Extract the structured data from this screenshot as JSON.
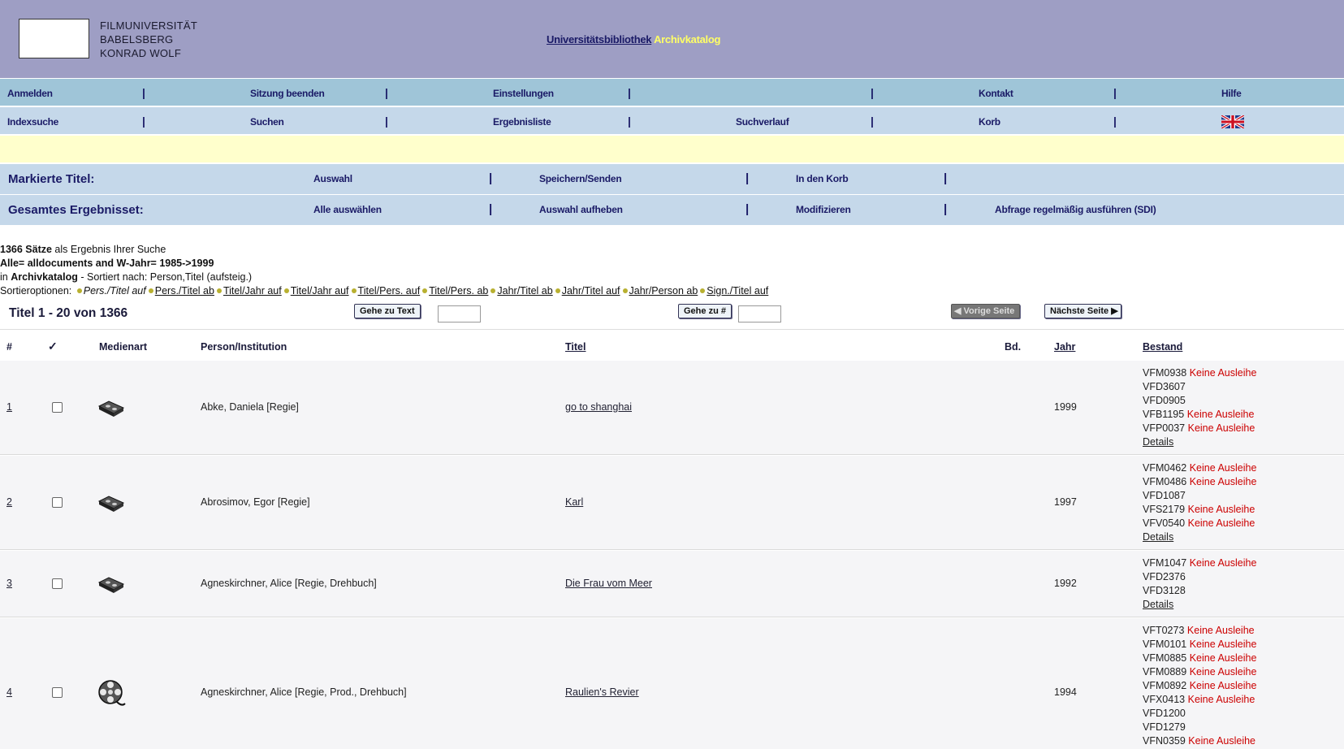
{
  "header": {
    "logo_lines": [
      "FILMUNIVERSITÄT",
      "BABELSBERG",
      "KONRAD WOLF"
    ],
    "library_link": "Universitätsbibliothek",
    "catalog": "Archivkatalog"
  },
  "nav1": [
    "Anmelden",
    "Sitzung beenden",
    "Einstellungen",
    "",
    "Kontakt",
    "Hilfe"
  ],
  "nav2": [
    "Indexsuche",
    "Suchen",
    "Ergebnisliste",
    "Suchverlauf",
    "Korb"
  ],
  "separator": "|",
  "marked": {
    "label": "Markierte Titel:",
    "items": [
      "Auswahl",
      "Speichern/Senden",
      "In den Korb"
    ]
  },
  "all": {
    "label": "Gesamtes Ergebnisset:",
    "items": [
      "Alle auswählen",
      "Auswahl aufheben",
      "Modifizieren",
      "Abfrage regelmäßig ausführen (SDI)"
    ]
  },
  "info": {
    "count_bold": "1366 Sätze",
    "count_rest": " als Ergebnis Ihrer Suche",
    "query": "Alle= alldocuments and W-Jahr= 1985->1999",
    "in_prefix": "in ",
    "in_catalog": "Archivkatalog",
    "sorted": " - Sortiert nach: Person,Titel (aufsteig.)",
    "sort_label": "Sortieroptionen: ",
    "sort_current": "Pers./Titel auf",
    "sort_options": [
      "Pers./Titel ab",
      "Titel/Jahr auf",
      "Titel/Jahr auf",
      "Titel/Pers. auf",
      "Titel/Pers. ab",
      "Jahr/Titel ab",
      "Jahr/Titel auf",
      "Jahr/Person ab",
      "Sign./Titel auf"
    ]
  },
  "titlebar": {
    "range": "Titel 1 - 20 von 1366",
    "goto_text": "Gehe zu Text",
    "goto_num": "Gehe zu #",
    "prev": "Vorige Seite",
    "next": "Nächste Seite"
  },
  "columns": {
    "num": "#",
    "check": "✓",
    "media": "Medienart",
    "person": "Person/Institution",
    "title": "Titel",
    "vol": "Bd.",
    "year": "Jahr",
    "holdings": "Bestand"
  },
  "rows": [
    {
      "num": "1",
      "media": "video-cassette-icon",
      "person": "Abke, Daniela [Regie]",
      "title": "go to shanghai ",
      "year": "1999",
      "holdings": [
        {
          "sig": "VFM0938",
          "status": "Keine Ausleihe"
        },
        {
          "sig": "VFD3607",
          "status": ""
        },
        {
          "sig": "VFD0905",
          "status": ""
        },
        {
          "sig": "VFB1195",
          "status": "Keine Ausleihe"
        },
        {
          "sig": "VFP0037",
          "status": "Keine Ausleihe"
        }
      ]
    },
    {
      "num": "2",
      "media": "video-cassette-icon",
      "person": "Abrosimov, Egor [Regie]",
      "title": "Karl ",
      "year": "1997",
      "holdings": [
        {
          "sig": "VFM0462",
          "status": "Keine Ausleihe"
        },
        {
          "sig": "VFM0486",
          "status": "Keine Ausleihe"
        },
        {
          "sig": "VFD1087",
          "status": ""
        },
        {
          "sig": "VFS2179",
          "status": "Keine Ausleihe"
        },
        {
          "sig": "VFV0540",
          "status": "Keine Ausleihe"
        }
      ]
    },
    {
      "num": "3",
      "media": "video-cassette-icon",
      "person": "Agneskirchner, Alice [Regie, Drehbuch]",
      "title": "Die Frau vom Meer ",
      "year": "1992",
      "holdings": [
        {
          "sig": "VFM1047",
          "status": "Keine Ausleihe"
        },
        {
          "sig": "VFD2376",
          "status": ""
        },
        {
          "sig": "VFD3128",
          "status": ""
        }
      ]
    },
    {
      "num": "4",
      "media": "film-reel-icon",
      "person": "Agneskirchner, Alice [Regie, Prod., Drehbuch]",
      "title": "Raulien's Revier ",
      "year": "1994",
      "holdings": [
        {
          "sig": "VFT0273",
          "status": "Keine Ausleihe"
        },
        {
          "sig": "VFM0101",
          "status": "Keine Ausleihe"
        },
        {
          "sig": "VFM0885",
          "status": "Keine Ausleihe"
        },
        {
          "sig": "VFM0889",
          "status": "Keine Ausleihe"
        },
        {
          "sig": "VFM0892",
          "status": "Keine Ausleihe"
        },
        {
          "sig": "VFX0413",
          "status": "Keine Ausleihe"
        },
        {
          "sig": "VFD1200",
          "status": ""
        },
        {
          "sig": "VFD1279",
          "status": ""
        },
        {
          "sig": "VFN0359",
          "status": "Keine Ausleihe"
        }
      ]
    }
  ],
  "details_label": "Details"
}
